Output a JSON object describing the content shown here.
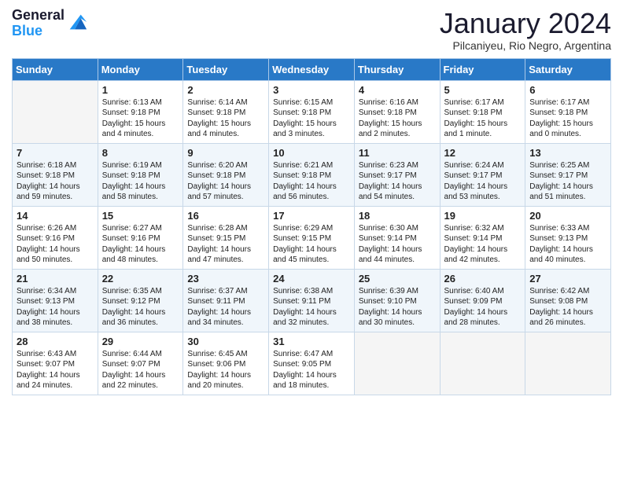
{
  "header": {
    "logo_line1": "General",
    "logo_line2": "Blue",
    "month": "January 2024",
    "location": "Pilcaniyeu, Rio Negro, Argentina"
  },
  "days_of_week": [
    "Sunday",
    "Monday",
    "Tuesday",
    "Wednesday",
    "Thursday",
    "Friday",
    "Saturday"
  ],
  "weeks": [
    [
      {
        "day": "",
        "info": ""
      },
      {
        "day": "1",
        "info": "Sunrise: 6:13 AM\nSunset: 9:18 PM\nDaylight: 15 hours\nand 4 minutes."
      },
      {
        "day": "2",
        "info": "Sunrise: 6:14 AM\nSunset: 9:18 PM\nDaylight: 15 hours\nand 4 minutes."
      },
      {
        "day": "3",
        "info": "Sunrise: 6:15 AM\nSunset: 9:18 PM\nDaylight: 15 hours\nand 3 minutes."
      },
      {
        "day": "4",
        "info": "Sunrise: 6:16 AM\nSunset: 9:18 PM\nDaylight: 15 hours\nand 2 minutes."
      },
      {
        "day": "5",
        "info": "Sunrise: 6:17 AM\nSunset: 9:18 PM\nDaylight: 15 hours\nand 1 minute."
      },
      {
        "day": "6",
        "info": "Sunrise: 6:17 AM\nSunset: 9:18 PM\nDaylight: 15 hours\nand 0 minutes."
      }
    ],
    [
      {
        "day": "7",
        "info": "Sunrise: 6:18 AM\nSunset: 9:18 PM\nDaylight: 14 hours\nand 59 minutes."
      },
      {
        "day": "8",
        "info": "Sunrise: 6:19 AM\nSunset: 9:18 PM\nDaylight: 14 hours\nand 58 minutes."
      },
      {
        "day": "9",
        "info": "Sunrise: 6:20 AM\nSunset: 9:18 PM\nDaylight: 14 hours\nand 57 minutes."
      },
      {
        "day": "10",
        "info": "Sunrise: 6:21 AM\nSunset: 9:18 PM\nDaylight: 14 hours\nand 56 minutes."
      },
      {
        "day": "11",
        "info": "Sunrise: 6:23 AM\nSunset: 9:17 PM\nDaylight: 14 hours\nand 54 minutes."
      },
      {
        "day": "12",
        "info": "Sunrise: 6:24 AM\nSunset: 9:17 PM\nDaylight: 14 hours\nand 53 minutes."
      },
      {
        "day": "13",
        "info": "Sunrise: 6:25 AM\nSunset: 9:17 PM\nDaylight: 14 hours\nand 51 minutes."
      }
    ],
    [
      {
        "day": "14",
        "info": "Sunrise: 6:26 AM\nSunset: 9:16 PM\nDaylight: 14 hours\nand 50 minutes."
      },
      {
        "day": "15",
        "info": "Sunrise: 6:27 AM\nSunset: 9:16 PM\nDaylight: 14 hours\nand 48 minutes."
      },
      {
        "day": "16",
        "info": "Sunrise: 6:28 AM\nSunset: 9:15 PM\nDaylight: 14 hours\nand 47 minutes."
      },
      {
        "day": "17",
        "info": "Sunrise: 6:29 AM\nSunset: 9:15 PM\nDaylight: 14 hours\nand 45 minutes."
      },
      {
        "day": "18",
        "info": "Sunrise: 6:30 AM\nSunset: 9:14 PM\nDaylight: 14 hours\nand 44 minutes."
      },
      {
        "day": "19",
        "info": "Sunrise: 6:32 AM\nSunset: 9:14 PM\nDaylight: 14 hours\nand 42 minutes."
      },
      {
        "day": "20",
        "info": "Sunrise: 6:33 AM\nSunset: 9:13 PM\nDaylight: 14 hours\nand 40 minutes."
      }
    ],
    [
      {
        "day": "21",
        "info": "Sunrise: 6:34 AM\nSunset: 9:13 PM\nDaylight: 14 hours\nand 38 minutes."
      },
      {
        "day": "22",
        "info": "Sunrise: 6:35 AM\nSunset: 9:12 PM\nDaylight: 14 hours\nand 36 minutes."
      },
      {
        "day": "23",
        "info": "Sunrise: 6:37 AM\nSunset: 9:11 PM\nDaylight: 14 hours\nand 34 minutes."
      },
      {
        "day": "24",
        "info": "Sunrise: 6:38 AM\nSunset: 9:11 PM\nDaylight: 14 hours\nand 32 minutes."
      },
      {
        "day": "25",
        "info": "Sunrise: 6:39 AM\nSunset: 9:10 PM\nDaylight: 14 hours\nand 30 minutes."
      },
      {
        "day": "26",
        "info": "Sunrise: 6:40 AM\nSunset: 9:09 PM\nDaylight: 14 hours\nand 28 minutes."
      },
      {
        "day": "27",
        "info": "Sunrise: 6:42 AM\nSunset: 9:08 PM\nDaylight: 14 hours\nand 26 minutes."
      }
    ],
    [
      {
        "day": "28",
        "info": "Sunrise: 6:43 AM\nSunset: 9:07 PM\nDaylight: 14 hours\nand 24 minutes."
      },
      {
        "day": "29",
        "info": "Sunrise: 6:44 AM\nSunset: 9:07 PM\nDaylight: 14 hours\nand 22 minutes."
      },
      {
        "day": "30",
        "info": "Sunrise: 6:45 AM\nSunset: 9:06 PM\nDaylight: 14 hours\nand 20 minutes."
      },
      {
        "day": "31",
        "info": "Sunrise: 6:47 AM\nSunset: 9:05 PM\nDaylight: 14 hours\nand 18 minutes."
      },
      {
        "day": "",
        "info": ""
      },
      {
        "day": "",
        "info": ""
      },
      {
        "day": "",
        "info": ""
      }
    ]
  ]
}
